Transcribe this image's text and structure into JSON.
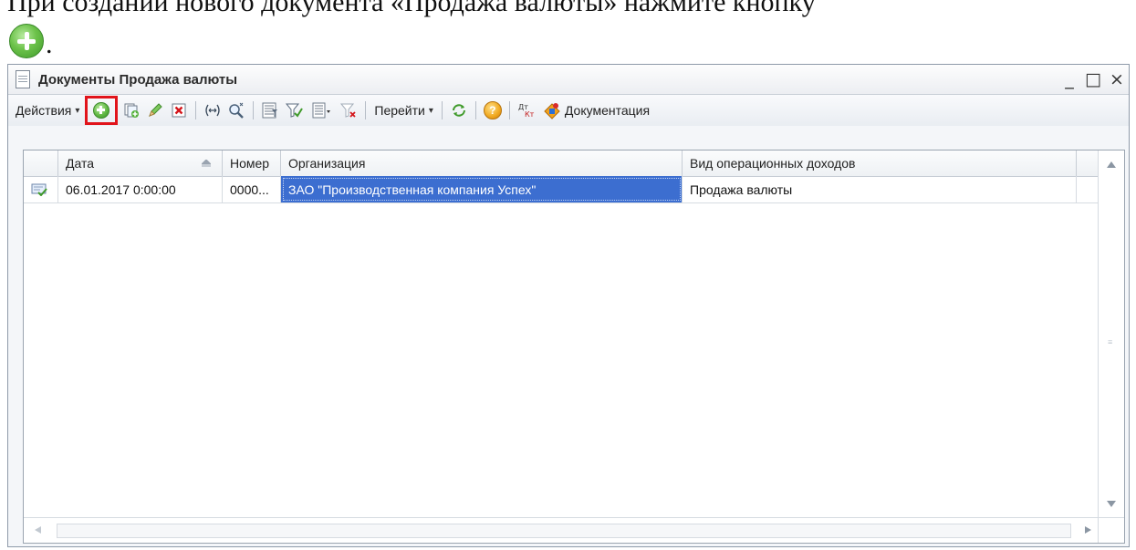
{
  "document": {
    "cropped_line": "При создании нового документа «Продажа валюты» нажмите кнопку",
    "period": "."
  },
  "window": {
    "title": "Документы Продажа валюты",
    "minimize_label": "_",
    "maximize_label": "□",
    "close_label": "×"
  },
  "toolbar": {
    "actions_label": "Действия",
    "goto_label": "Перейти",
    "dtkt_label": "Дт Кт",
    "documentation_label": "Документация",
    "dropdown_arrow": "▾",
    "help_glyph": "?",
    "highlight_color": "#e1141b"
  },
  "table": {
    "columns": [
      "Дата",
      "Номер",
      "Организация",
      "Вид операционных доходов"
    ],
    "rows": [
      {
        "date": "06.01.2017 0:00:00",
        "number": "0000...",
        "organization": "ЗАО \"Производственная компания Успех\"",
        "income_type": "Продажа валюты"
      }
    ],
    "selection_color": "#3c6ed0"
  },
  "icons": [
    "document-icon",
    "add-icon",
    "copy-icon",
    "edit-icon",
    "delete-icon",
    "interval-icon",
    "search-icon",
    "filter-icon",
    "filter-value-icon",
    "filter-dropdown-icon",
    "clear-filter-icon",
    "refresh-icon",
    "help-icon",
    "dtkt-icon",
    "documentation-icon",
    "posted-document-icon"
  ]
}
